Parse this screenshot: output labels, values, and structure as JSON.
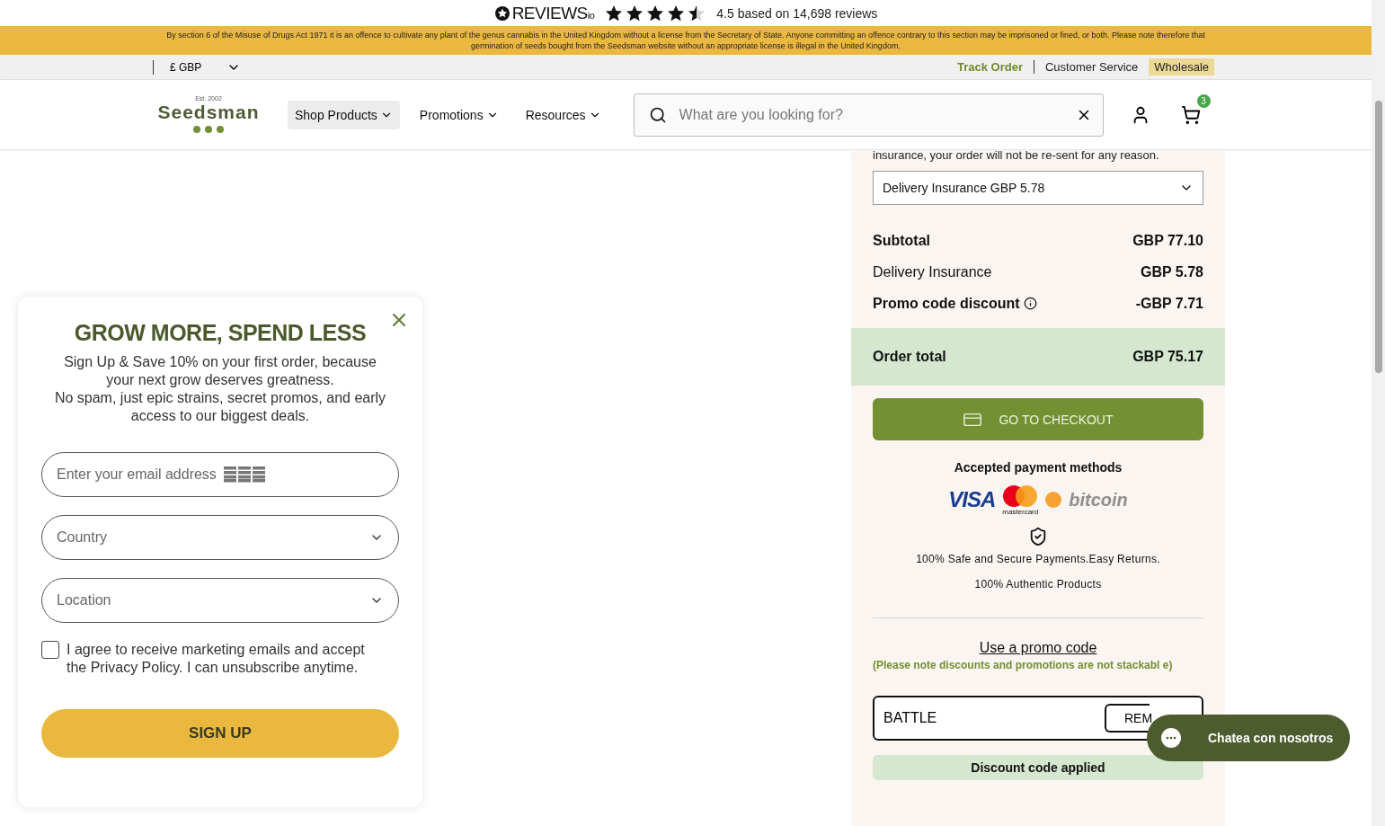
{
  "reviews_bar": {
    "brand": "REVIEWS",
    "brand_suffix": "io",
    "stars": 4.5,
    "rating_text": "4.5 based on 14,698 reviews"
  },
  "legal_banner": "By section 6 of the Misuse of Drugs Act 1971 it is an offence to cultivate any plant of the genus cannabis in the United Kingdom without a license from the Secretary of State. Anyone committing an offence contrary to this section may be imprisoned or fined, or both. Please note therefore that germination of seeds bought from the Seedsman website without an appropriate license is illegal in the United Kingdom.",
  "utility_bar": {
    "currency": "£ GBP",
    "links": [
      {
        "label": "Track Order",
        "kind": "highlight"
      },
      {
        "label": "Customer Service",
        "kind": "plain"
      },
      {
        "label": "Wholesale",
        "kind": "badge"
      }
    ]
  },
  "header": {
    "logo": {
      "tagline": "Est. 2002",
      "name": "Seedsman"
    },
    "nav": [
      {
        "label": "Shop Products",
        "selected": true
      },
      {
        "label": "Promotions",
        "selected": false
      },
      {
        "label": "Resources",
        "selected": false
      }
    ],
    "search": {
      "placeholder": "What are you looking for?"
    },
    "cart_count": "3"
  },
  "order_summary": {
    "insurance_note": "insurance, your order will not be re-sent for any reason.",
    "insurance_select": "Delivery Insurance GBP 5.78",
    "lines": [
      {
        "label": "Subtotal",
        "value": "GBP 77.10",
        "kind": "bold"
      },
      {
        "label": "Delivery Insurance",
        "value": "GBP 5.78",
        "kind": "plain"
      },
      {
        "label": "Promo code discount",
        "value": "-GBP 7.71",
        "kind": "info"
      }
    ],
    "total": {
      "label": "Order total",
      "value": "GBP 75.17"
    },
    "checkout_button": "GO TO CHECKOUT",
    "payments_title": "Accepted payment methods",
    "payments": {
      "visa": "VISA",
      "mastercard": "mastercard",
      "bitcoin": "bitcoin"
    },
    "assurances": [
      "100% Safe and Secure Payments.Easy Returns.",
      "100% Authentic Products"
    ],
    "promo_link": "Use a promo code",
    "promo_note": "(Please note discounts and promotions are not stackabl e)",
    "promo_value": "BATTLE",
    "promo_button": "REM",
    "promo_status": "Discount code applied"
  },
  "popup": {
    "title": "GROW MORE, SPEND LESS",
    "text": "Sign Up & Save 10% on your first order, because your next grow deserves greatness.",
    "text2": "No spam, just epic strains, secret promos, and early access to our biggest deals.",
    "email_placeholder": "Enter your email address",
    "selects": [
      "Country",
      "Location"
    ],
    "consent": {
      "checked": false,
      "text": "I agree to receive marketing emails and accept the Privacy Policy. I can unsubscribe anytime."
    },
    "button": "SIGN UP"
  },
  "chat": {
    "label": "Chatea con nosotros"
  }
}
